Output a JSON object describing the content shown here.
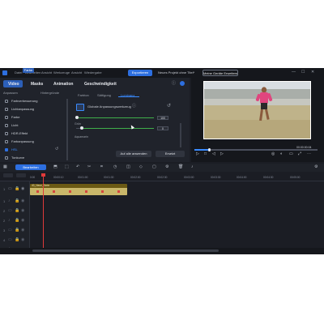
{
  "titlebar": {
    "menu": [
      "Datei",
      "Bearbeiten",
      "Ansicht",
      "Werkzeuge",
      "Ansicht",
      "Wiedergabe"
    ],
    "export_label": "Exportieren",
    "project_name": "Neues Projekt ohne Titel*",
    "smart_label": "Meine Geräte Erweitern"
  },
  "main_tabs": {
    "video": "Video",
    "masks": "Masks",
    "animation": "Animation",
    "speed": "Geschwindigkeit"
  },
  "sub_tabs": {
    "anpassen": "Anpassen",
    "farbe": "Farbe",
    "hintergrund": "Hintergründe"
  },
  "effects": [
    {
      "label": "Farbverbesserung",
      "checked": false
    },
    {
      "label": "Lichtanpassung",
      "checked": false
    },
    {
      "label": "Farbe",
      "checked": false
    },
    {
      "label": "Licht",
      "checked": false
    },
    {
      "label": "HDR-Effekt",
      "checked": false
    },
    {
      "label": "Farbanpassung",
      "checked": false
    },
    {
      "label": "HSL",
      "checked": true
    },
    {
      "label": "Tonkurve",
      "checked": false
    }
  ],
  "adjust_tabs": {
    "farbton": "Farbton",
    "saettigung": "Sättigung",
    "luminanz": "Luminanz"
  },
  "adjust": {
    "global_label": "Globale Anpassungswerkzeug",
    "slider1_value": "100",
    "slider1_label": "Grün",
    "slider2_value": "0",
    "slider2_label": "Aquamarin"
  },
  "buttons": {
    "apply_all": "Auf alle anwenden",
    "reset": "Ersetzt"
  },
  "preview": {
    "timecode": "00:00:00:04",
    "progress": 0.12
  },
  "toolbar": {
    "edit_label": "Bearbeiten"
  },
  "timeline": {
    "ticks": [
      "0:00",
      "00:00:10",
      "00:01:00",
      "00:01:30",
      "00:02:00",
      "00:02:30",
      "00:03:00",
      "00:03:30",
      "00:04:00",
      "00:04:30",
      "00:05:00"
    ],
    "clip_label": "40_Neue_Serie",
    "tracks": [
      "1",
      "1",
      "2",
      "2",
      "3",
      "4",
      "4"
    ]
  },
  "colors": {
    "accent": "#2d6fe0",
    "clip": "#6b5a14",
    "playhead": "#e03a3a",
    "slider_green": "#3fae4a"
  }
}
